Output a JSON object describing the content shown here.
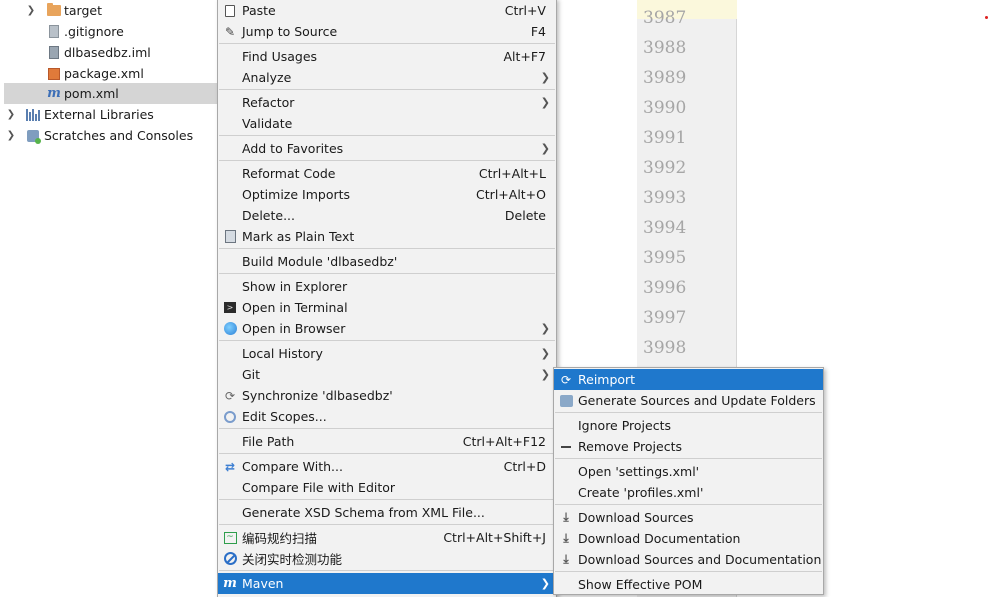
{
  "project_tree": {
    "items": [
      {
        "label": "target",
        "icon": "folder-icon"
      },
      {
        "label": ".gitignore",
        "icon": "file-icon"
      },
      {
        "label": "dlbasedbz.iml",
        "icon": "iml-file-icon"
      },
      {
        "label": "package.xml",
        "icon": "xml-file-icon"
      },
      {
        "label": "pom.xml",
        "icon": "maven-file-icon"
      },
      {
        "label": "External Libraries",
        "icon": "libraries-icon"
      },
      {
        "label": "Scratches and Consoles",
        "icon": "scratches-icon"
      }
    ]
  },
  "editor": {
    "line_numbers": [
      "3987",
      "3988",
      "3989",
      "3990",
      "3991",
      "3992",
      "3993",
      "3994",
      "3995",
      "3996",
      "3997",
      "3998"
    ]
  },
  "context_menu": {
    "items": [
      {
        "label": "Paste",
        "shortcut": "Ctrl+V"
      },
      {
        "label": "Jump to Source",
        "shortcut": "F4"
      },
      {
        "label": "Find Usages",
        "shortcut": "Alt+F7"
      },
      {
        "label": "Analyze",
        "shortcut": ""
      },
      {
        "label": "Refactor",
        "shortcut": ""
      },
      {
        "label": "Validate",
        "shortcut": ""
      },
      {
        "label": "Add to Favorites",
        "shortcut": ""
      },
      {
        "label": "Reformat Code",
        "shortcut": "Ctrl+Alt+L"
      },
      {
        "label": "Optimize Imports",
        "shortcut": "Ctrl+Alt+O"
      },
      {
        "label": "Delete...",
        "shortcut": "Delete"
      },
      {
        "label": "Mark as Plain Text",
        "shortcut": ""
      },
      {
        "label": "Build Module 'dlbasedbz'",
        "shortcut": ""
      },
      {
        "label": "Show in Explorer",
        "shortcut": ""
      },
      {
        "label": "Open in Terminal",
        "shortcut": ""
      },
      {
        "label": "Open in Browser",
        "shortcut": ""
      },
      {
        "label": "Local History",
        "shortcut": ""
      },
      {
        "label": "Git",
        "shortcut": ""
      },
      {
        "label": "Synchronize 'dlbasedbz'",
        "shortcut": ""
      },
      {
        "label": "Edit Scopes...",
        "shortcut": ""
      },
      {
        "label": "File Path",
        "shortcut": "Ctrl+Alt+F12"
      },
      {
        "label": "Compare With...",
        "shortcut": "Ctrl+D"
      },
      {
        "label": "Compare File with Editor",
        "shortcut": ""
      },
      {
        "label": "Generate XSD Schema from XML File...",
        "shortcut": ""
      },
      {
        "label": "编码规约扫描",
        "shortcut": "Ctrl+Alt+Shift+J"
      },
      {
        "label": "关闭实时检测功能",
        "shortcut": ""
      },
      {
        "label": "Maven",
        "shortcut": ""
      }
    ]
  },
  "maven_submenu": {
    "items": [
      {
        "label": "Reimport"
      },
      {
        "label": "Generate Sources and Update Folders"
      },
      {
        "label": "Ignore Projects"
      },
      {
        "label": "Remove Projects"
      },
      {
        "label": "Open 'settings.xml'"
      },
      {
        "label": "Create 'profiles.xml'"
      },
      {
        "label": "Download Sources"
      },
      {
        "label": "Download Documentation"
      },
      {
        "label": "Download Sources and Documentation"
      },
      {
        "label": "Show Effective POM"
      }
    ]
  },
  "colors": {
    "highlight": "#1f78cc",
    "selection_row": "#d5d5d5",
    "menu_bg": "#f2f2f2"
  }
}
